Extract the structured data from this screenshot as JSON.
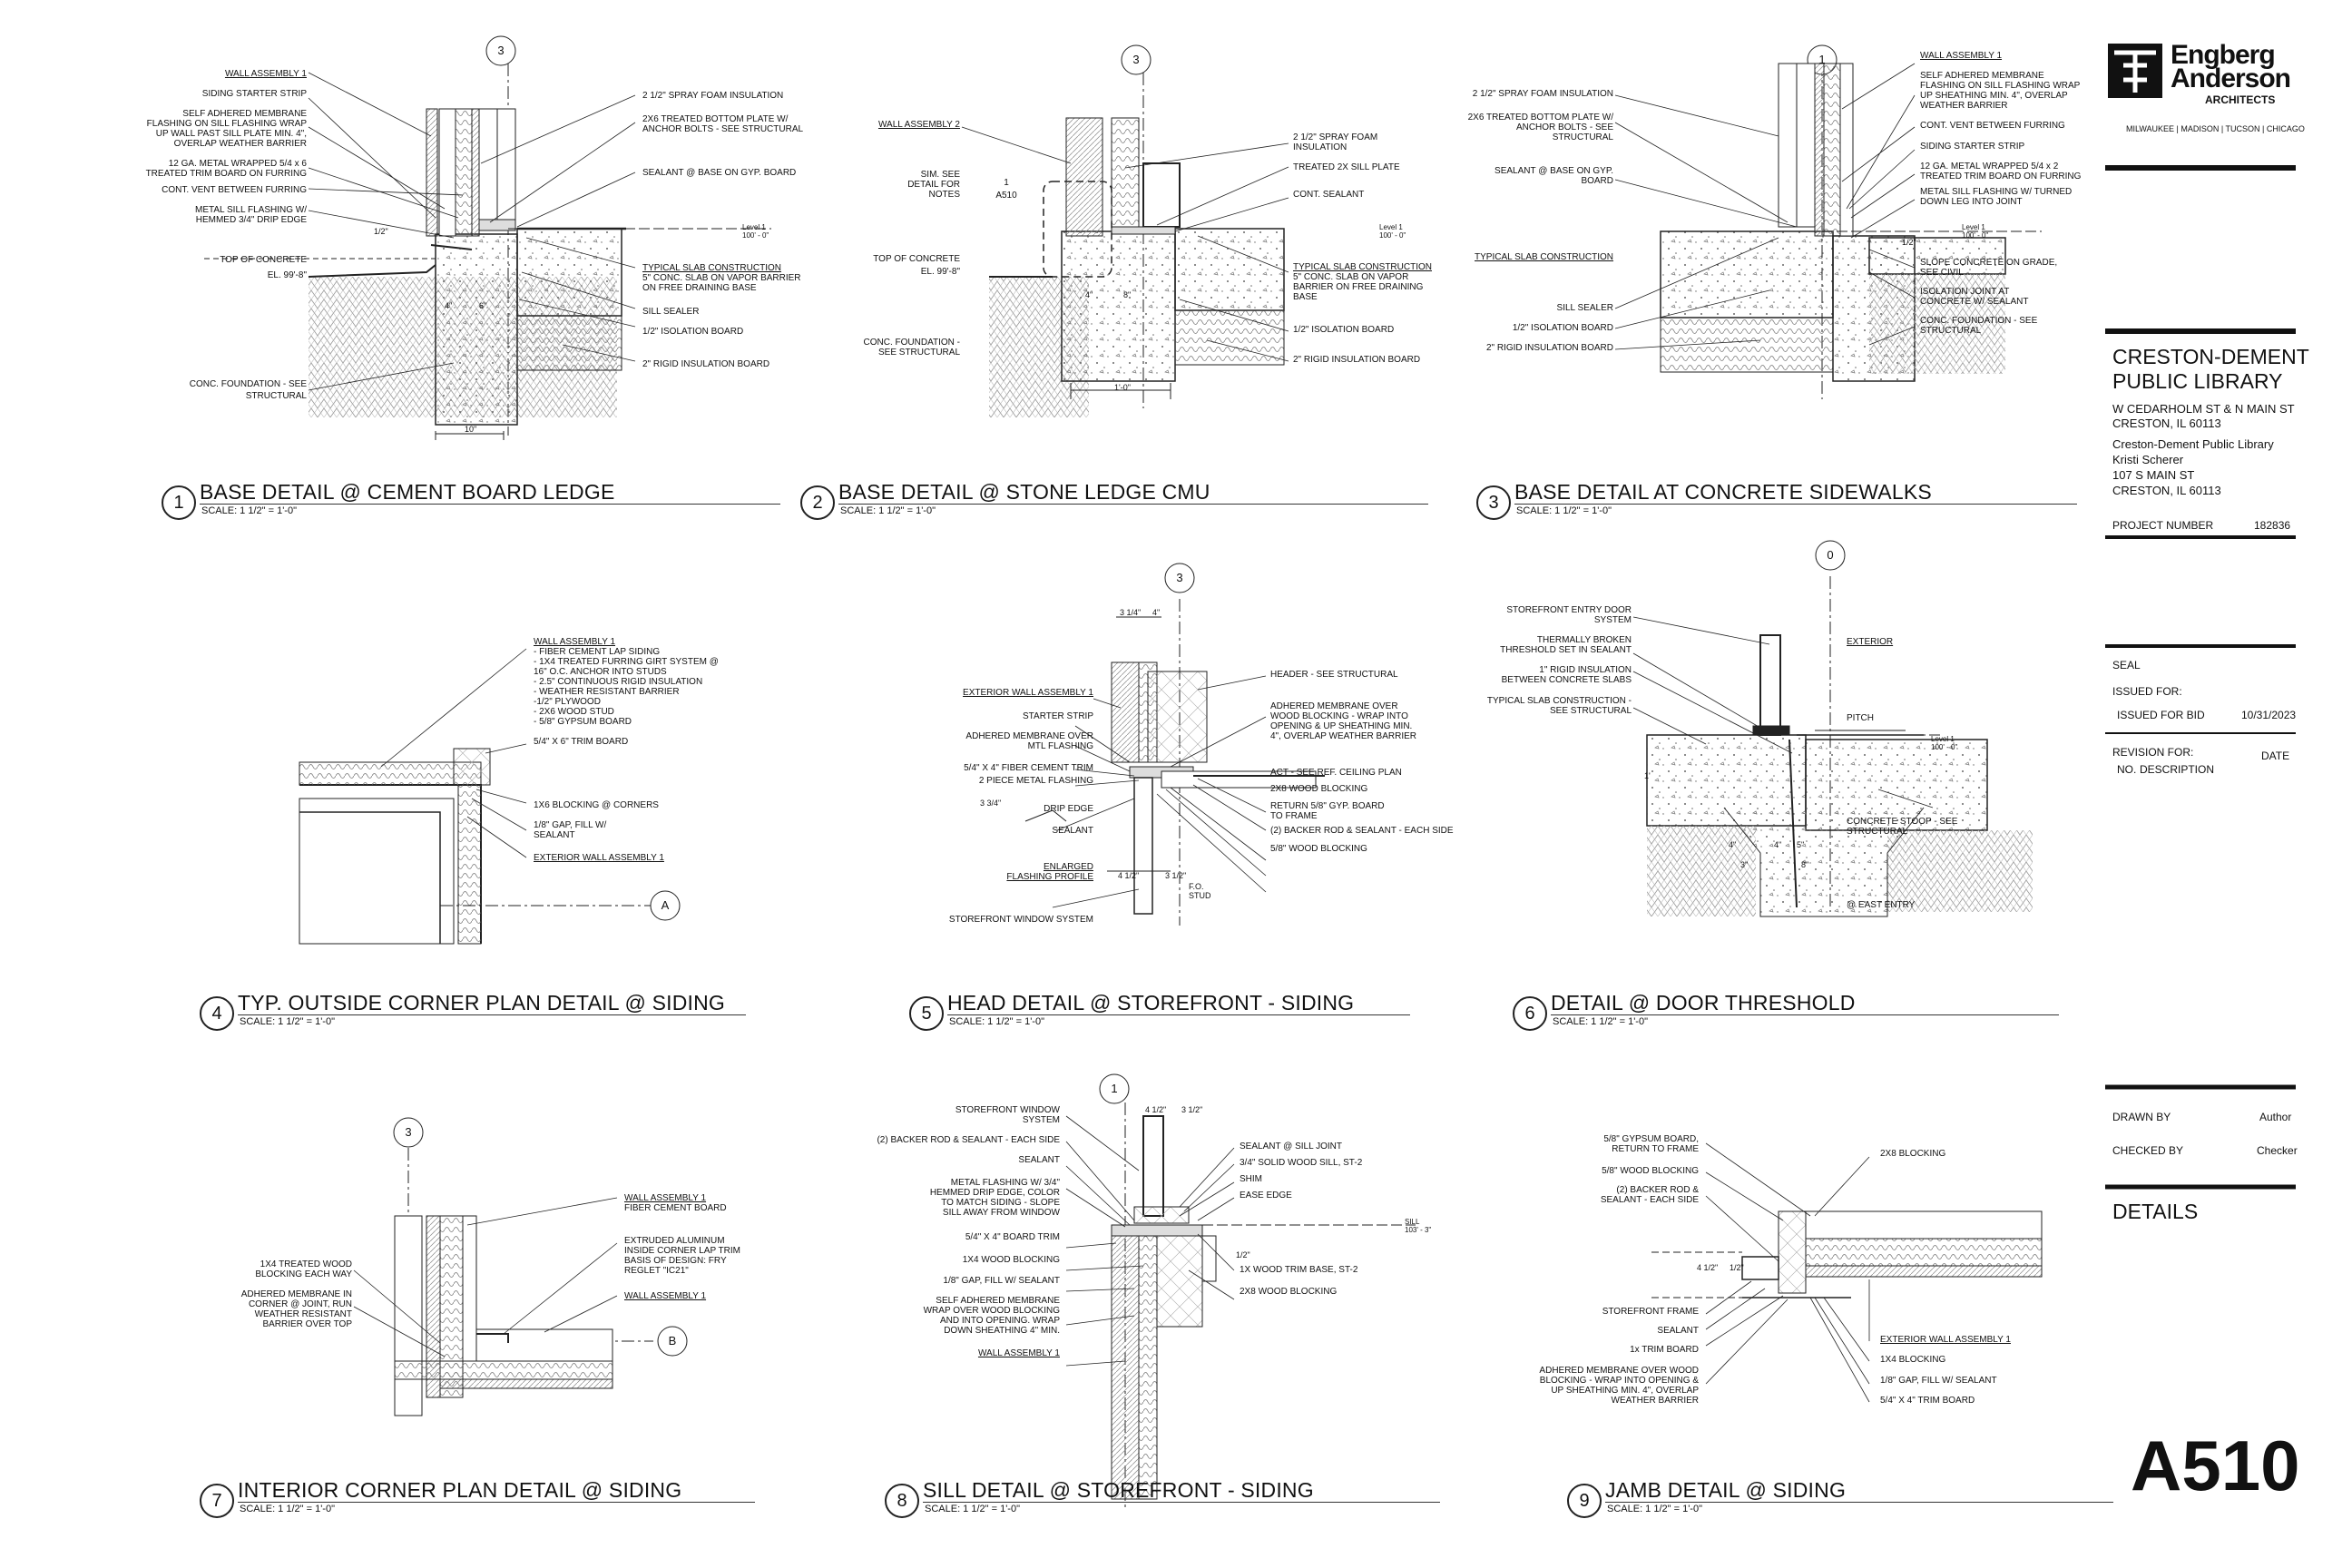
{
  "firm": {
    "name_line1": "Engberg",
    "name_line2": "Anderson",
    "name_line3": "ARCHITECTS",
    "offices": "MILWAUKEE | MADISON | TUCSON | CHICAGO"
  },
  "project": {
    "title_line1": "CRESTON-DEMENT",
    "title_line2": "PUBLIC LIBRARY",
    "address1": "W CEDARHOLM ST &  N MAIN ST",
    "address2": "CRESTON, IL 60113",
    "client1": "Creston-Dement Public Library",
    "client2": "Kristi Scherer",
    "client3": "107 S MAIN ST",
    "client4": "CRESTON, IL 60113",
    "number_label": "PROJECT NUMBER",
    "number": "182836"
  },
  "issue": {
    "seal": "SEAL",
    "issued_for_label": "ISSUED FOR:",
    "issued_for": "ISSUED FOR BID",
    "issued_date": "10/31/2023",
    "revision_label": "REVISION FOR:",
    "date_label": "DATE",
    "no_label": "NO.",
    "desc_label": "DESCRIPTION"
  },
  "credits": {
    "drawn_label": "DRAWN BY",
    "drawn": "Author",
    "checked_label": "CHECKED BY",
    "checked": "Checker"
  },
  "sheet": {
    "name": "DETAILS",
    "number": "A510"
  },
  "details": [
    {
      "num": "1",
      "title": "BASE DETAIL @ CEMENT BOARD LEDGE",
      "scale": "SCALE:  1 1/2\" = 1'-0\"",
      "grid": "3",
      "labels_left": [
        "WALL ASSEMBLY 1",
        "SIDING STARTER STRIP",
        "SELF ADHERED MEMBRANE",
        "FLASHING ON SILL FLASHING WRAP",
        "UP WALL PAST SILL PLATE MIN. 4\",",
        "OVERLAP WEATHER BARRIER",
        "12 GA. METAL WRAPPED 5/4 x 6",
        "TREATED TRIM BOARD ON FURRING",
        "CONT. VENT BETWEEN FURRING",
        "METAL SILL FLASHING W/",
        "HEMMED 3/4\" DRIP EDGE",
        "TOP OF CONCRETE",
        "EL. 99'-8\"",
        "CONC. FOUNDATION - SEE",
        "STRUCTURAL"
      ],
      "labels_right": [
        "2 1/2\" SPRAY FOAM INSULATION",
        "2X6 TREATED BOTTOM PLATE W/",
        "ANCHOR BOLTS - SEE STRUCTURAL",
        "SEALANT @ BASE ON GYP. BOARD",
        "TYPICAL SLAB CONSTRUCTION",
        "5\" CONC. SLAB ON VAPOR BARRIER",
        "ON FREE DRAINING BASE",
        "SILL SEALER",
        "1/2\" ISOLATION BOARD",
        "2\" RIGID INSULATION BOARD"
      ],
      "dims": [
        "10\"",
        "1/2\"",
        "4\"",
        "6\""
      ],
      "level": "Level 1",
      "level_el": "100' - 0\""
    },
    {
      "num": "2",
      "title": "BASE DETAIL @ STONE LEDGE CMU",
      "scale": "SCALE:  1 1/2\" = 1'-0\"",
      "grid": "3",
      "labels_left": [
        "WALL ASSEMBLY 2",
        "SIM. SEE",
        "DETAIL FOR",
        "NOTES",
        "TOP OF CONCRETE",
        "EL. 99'-8\"",
        "CONC. FOUNDATION -",
        "SEE STRUCTURAL"
      ],
      "labels_right": [
        "2 1/2\" SPRAY FOAM",
        "INSULATION",
        "TREATED 2X SILL PLATE",
        "CONT. SEALANT",
        "TYPICAL SLAB CONSTRUCTION",
        "5\" CONC. SLAB ON VAPOR",
        "BARRIER ON FREE DRAINING",
        "BASE",
        "1/2\"  ISOLATION BOARD",
        "2\" RIGID INSULATION BOARD"
      ],
      "callout_num": "1",
      "callout_sheet": "A510",
      "dims": [
        "1'-0\"",
        "4\"",
        "8\""
      ],
      "level": "Level 1",
      "level_el": "100' - 0\""
    },
    {
      "num": "3",
      "title": "BASE DETAIL AT CONCRETE SIDEWALKS",
      "scale": "SCALE:  1 1/2\" = 1'-0\"",
      "grid": "1",
      "labels_left": [
        "2 1/2\" SPRAY FOAM INSULATION",
        "2X6 TREATED BOTTOM PLATE W/",
        "ANCHOR BOLTS - SEE",
        "STRUCTURAL",
        "SEALANT @ BASE ON GYP.",
        "BOARD",
        "TYPICAL SLAB CONSTRUCTION",
        "SILL SEALER",
        "1/2\" ISOLATION BOARD",
        "2\" RIGID INSULATION BOARD"
      ],
      "labels_right": [
        "WALL ASSEMBLY 1",
        "SELF ADHERED MEMBRANE",
        "FLASHING ON SILL FLASHING WRAP",
        "UP SHEATHING MIN. 4\",  OVERLAP",
        "WEATHER BARRIER",
        "CONT. VENT BETWEEN FURRING",
        "SIDING STARTER STRIP",
        "12 GA. METAL WRAPPED 5/4 x 2",
        "TREATED TRIM BOARD ON FURRING",
        "METAL SILL FLASHING W/ TURNED",
        "DOWN LEG INTO JOINT",
        "SLOPE CONCRETE ON GRADE,",
        "SEE CIVIL",
        "ISOLATION JOINT AT",
        "CONCRETE W/ SEALANT",
        "CONC. FOUNDATION - SEE",
        "STRUCTURAL"
      ],
      "dims": [
        "1/2\""
      ],
      "level": "Level 1",
      "level_el": "100' - 0\""
    },
    {
      "num": "4",
      "title": "TYP. OUTSIDE CORNER PLAN DETAIL @ SIDING",
      "scale": "SCALE:  1 1/2\" = 1'-0\"",
      "grid": "A",
      "labels_right": [
        "WALL ASSEMBLY 1",
        "- FIBER CEMENT LAP SIDING",
        "- 1X4 TREATED FURRING GIRT SYSTEM @",
        "  16\" O.C. ANCHOR INTO STUDS",
        "- 2.5\" CONTINUOUS RIGID INSULATION",
        "- WEATHER RESISTANT BARRIER",
        "-1/2\" PLYWOOD",
        "- 2X6 WOOD STUD",
        "- 5/8\" GYPSUM BOARD",
        "5/4\" X 6\" TRIM BOARD",
        "1X6 BLOCKING @ CORNERS",
        "1/8\" GAP, FILL W/",
        "SEALANT",
        "EXTERIOR WALL ASSEMBLY 1"
      ]
    },
    {
      "num": "5",
      "title": "HEAD DETAIL @ STOREFRONT - SIDING",
      "scale": "SCALE:  1 1/2\" = 1'-0\"",
      "grid": "3",
      "labels_left": [
        "EXTERIOR WALL ASSEMBLY 1",
        "STARTER STRIP",
        "ADHERED MEMBRANE OVER",
        "MTL FLASHING",
        "5/4\" X 4\" FIBER CEMENT TRIM",
        "2 PIECE METAL FLASHING",
        "DRIP EDGE",
        "SEALANT",
        "ENLARGED",
        "FLASHING PROFILE",
        "STOREFRONT WINDOW SYSTEM"
      ],
      "labels_right": [
        "HEADER - SEE STRUCTURAL",
        "ADHERED MEMBRANE OVER",
        "WOOD BLOCKING - WRAP INTO",
        "OPENING & UP SHEATHING MIN.",
        "4\", OVERLAP WEATHER BARRIER",
        "ACT - SEE REF. CEILING PLAN",
        "2X8 WOOD BLOCKING",
        "RETURN 5/8\" GYP. BOARD",
        "TO FRAME",
        "(2) BACKER ROD & SEALANT - EACH SIDE",
        "5/8\" WOOD BLOCKING"
      ],
      "dims": [
        "3 1/4\"",
        "4\"",
        "4 1/2\"",
        "3 1/2\"",
        "3 3/4\"",
        "F.O.",
        "STUD"
      ]
    },
    {
      "num": "6",
      "title": "DETAIL @ DOOR THRESHOLD",
      "scale": "SCALE:  1 1/2\" = 1'-0\"",
      "grid": "0",
      "labels_left": [
        "STOREFRONT ENTRY DOOR",
        "SYSTEM",
        "THERMALLY BROKEN",
        "THRESHOLD SET IN SEALANT",
        "1\" RIGID INSULATION",
        "BETWEEN CONCRETE SLABS",
        "TYPICAL SLAB CONSTRUCTION -",
        "SEE STRUCTURAL"
      ],
      "labels_right": [
        "EXTERIOR",
        "PITCH",
        "CONCRETE STOOP - SEE",
        "STRUCTURAL",
        "@ EAST ENTRY"
      ],
      "dims": [
        "4\"",
        "4\"",
        "3\"",
        "8\"",
        "5\"",
        "1'"
      ],
      "level": "Level 1",
      "level_el": "100' - 0\""
    },
    {
      "num": "7",
      "title": "INTERIOR CORNER PLAN DETAIL @ SIDING",
      "scale": "SCALE:  1 1/2\" = 1'-0\"",
      "grid": "3",
      "grid2": "B",
      "labels_left": [
        "1X4 TREATED WOOD",
        "BLOCKING EACH WAY",
        "ADHERED MEMBRANE IN",
        "CORNER @ JOINT, RUN",
        "WEATHER RESISTANT",
        "BARRIER OVER TOP"
      ],
      "labels_right": [
        "WALL ASSEMBLY 1",
        "FIBER CEMENT BOARD",
        "EXTRUDED ALUMINUM",
        "INSIDE CORNER LAP TRIM",
        "BASIS OF DESIGN: FRY",
        "REGLET \"IC21\"",
        "WALL ASSEMBLY 1"
      ]
    },
    {
      "num": "8",
      "title": "SILL DETAIL @ STOREFRONT - SIDING",
      "scale": "SCALE:  1 1/2\" = 1'-0\"",
      "grid": "1",
      "labels_left": [
        "STOREFRONT WINDOW",
        "SYSTEM",
        "(2) BACKER ROD & SEALANT - EACH SIDE",
        "SEALANT",
        "METAL FLASHING W/ 3/4\"",
        "HEMMED DRIP EDGE, COLOR",
        "TO MATCH SIDING - SLOPE",
        "SILL AWAY FROM WINDOW",
        "5/4\" X 4\" BOARD TRIM",
        "1X4 WOOD BLOCKING",
        "1/8\" GAP, FILL W/ SEALANT",
        "SELF ADHERED MEMBRANE",
        "WRAP OVER WOOD BLOCKING",
        "AND INTO OPENING. WRAP",
        "DOWN SHEATHING 4\" MIN.",
        "WALL ASSEMBLY 1"
      ],
      "labels_right": [
        "SEALANT @ SILL JOINT",
        "3/4\" SOLID WOOD SILL, ST-2",
        "SHIM",
        "EASE EDGE",
        "1X WOOD TRIM BASE, ST-2",
        "2X8 WOOD BLOCKING"
      ],
      "dims": [
        "4 1/2\"",
        "3 1/2\"",
        "1/2\""
      ],
      "level": "SILL",
      "level_el": "103' - 3\""
    },
    {
      "num": "9",
      "title": "JAMB DETAIL @ SIDING",
      "scale": "SCALE:  1 1/2\" = 1'-0\"",
      "labels_left": [
        "5/8\" GYPSUM BOARD,",
        "RETURN TO FRAME",
        "5/8\" WOOD BLOCKING",
        "(2) BACKER ROD &",
        "SEALANT - EACH SIDE",
        "STOREFRONT FRAME",
        "SEALANT",
        "1x TRIM BOARD",
        "ADHERED MEMBRANE OVER WOOD",
        "BLOCKING - WRAP INTO OPENING &",
        "UP SHEATHING MIN. 4\", OVERLAP",
        "WEATHER BARRIER"
      ],
      "labels_right": [
        "2X8 BLOCKING",
        "EXTERIOR WALL ASSEMBLY 1",
        "1X4 BLOCKING",
        "1/8\" GAP, FILL W/ SEALANT",
        "5/4\" X 4\" TRIM BOARD"
      ],
      "dims": [
        "4 1/2\"",
        "1/2\""
      ]
    }
  ]
}
